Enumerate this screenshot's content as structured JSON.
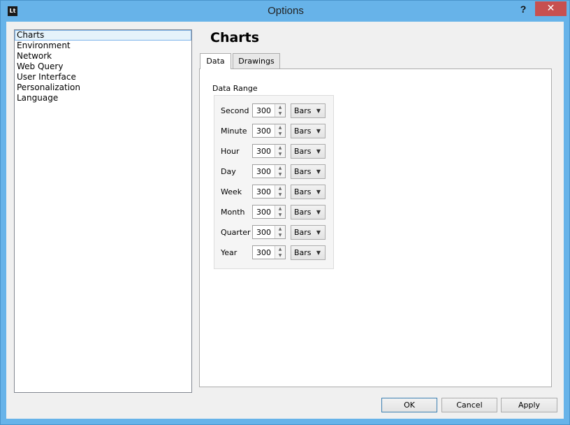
{
  "window": {
    "title": "Options",
    "icon_text": "Lt",
    "help_label": "?",
    "close_label": "✕"
  },
  "nav": {
    "items": [
      "Charts",
      "Environment",
      "Network",
      "Web Query",
      "User Interface",
      "Personalization",
      "Language"
    ],
    "selected": "Charts"
  },
  "page": {
    "title": "Charts"
  },
  "tabs": [
    {
      "label": "Data",
      "active": true
    },
    {
      "label": "Drawings",
      "active": false
    }
  ],
  "data_range": {
    "label": "Data Range",
    "rows": [
      {
        "label": "Second",
        "value": "300",
        "unit": "Bars"
      },
      {
        "label": "Minute",
        "value": "300",
        "unit": "Bars"
      },
      {
        "label": "Hour",
        "value": "300",
        "unit": "Bars"
      },
      {
        "label": "Day",
        "value": "300",
        "unit": "Bars"
      },
      {
        "label": "Week",
        "value": "300",
        "unit": "Bars"
      },
      {
        "label": "Month",
        "value": "300",
        "unit": "Bars"
      },
      {
        "label": "Quarter",
        "value": "300",
        "unit": "Bars"
      },
      {
        "label": "Year",
        "value": "300",
        "unit": "Bars"
      }
    ]
  },
  "buttons": {
    "ok": "OK",
    "cancel": "Cancel",
    "apply": "Apply"
  },
  "colors": {
    "titlebar": "#67b3e9",
    "close": "#c75050",
    "selection": "#e5f3fb"
  }
}
